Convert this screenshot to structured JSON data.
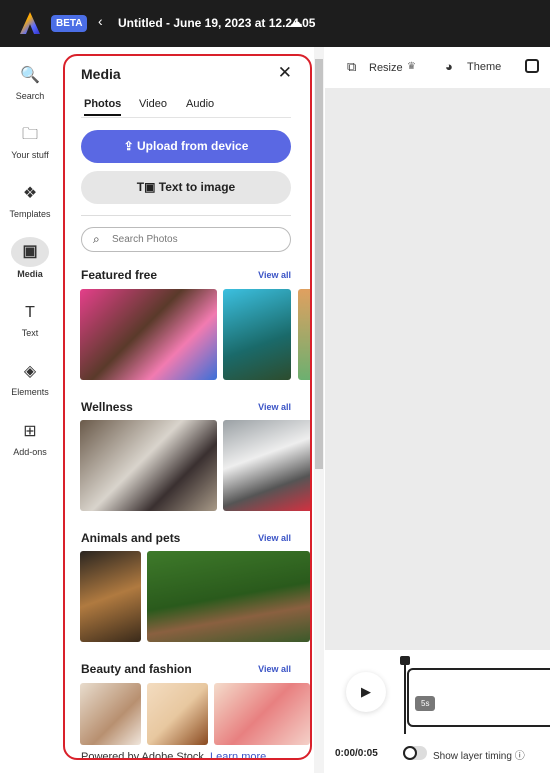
{
  "topbar": {
    "beta": "BETA",
    "title": "Untitled - June 19, 2023 at 12.24.05"
  },
  "rail": [
    {
      "label": "Search",
      "icon": "🔍"
    },
    {
      "label": "Your stuff",
      "icon": "🗀"
    },
    {
      "label": "Templates",
      "icon": "❖"
    },
    {
      "label": "Media",
      "icon": "▣"
    },
    {
      "label": "Text",
      "icon": "T"
    },
    {
      "label": "Elements",
      "icon": "◈"
    },
    {
      "label": "Add-ons",
      "icon": "⊞"
    }
  ],
  "panel": {
    "title": "Media",
    "tabs": [
      "Photos",
      "Video",
      "Audio"
    ],
    "upload": "Upload from device",
    "text_to_image": "Text to image",
    "search_placeholder": "Search Photos",
    "sections": [
      {
        "title": "Featured free",
        "view_all": "View all"
      },
      {
        "title": "Wellness",
        "view_all": "View all"
      },
      {
        "title": "Animals and pets",
        "view_all": "View all"
      },
      {
        "title": "Beauty and fashion",
        "view_all": "View all"
      }
    ],
    "footer": "Powered by Adobe Stock.",
    "learn_more": "Learn more"
  },
  "toolbar": {
    "resize": "Resize",
    "theme": "Theme"
  },
  "timeline": {
    "duration": "5s",
    "time": "0:00/0:05",
    "show_layer_timing": "Show layer timing"
  }
}
